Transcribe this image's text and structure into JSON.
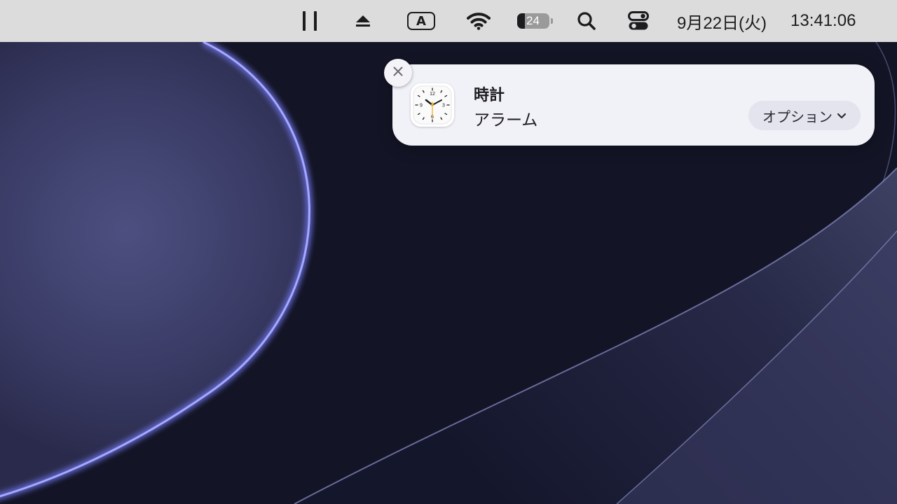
{
  "menubar": {
    "battery_percent": "24",
    "battery_level": 0.24,
    "date": "9月22日(火)",
    "time": "13:41:06",
    "input_method": "A",
    "icons": [
      "pause-icon",
      "eject-icon",
      "input-source-icon",
      "wifi-icon",
      "battery-icon",
      "search-icon",
      "control-center-icon"
    ]
  },
  "notification": {
    "app_name": "時計",
    "message": "アラーム",
    "options_label": "オプション",
    "app_icon": "clock-app-icon",
    "close_icon": "close-icon",
    "options_chevron": "chevron-down-icon"
  },
  "clock_icon": {
    "numerals": [
      "12",
      "3",
      "6",
      "9"
    ]
  },
  "colors": {
    "menubar_bg": "#dcdcdc",
    "notification_bg": "#f1f1f8",
    "wallpaper_accent": "#7b7fe0"
  }
}
